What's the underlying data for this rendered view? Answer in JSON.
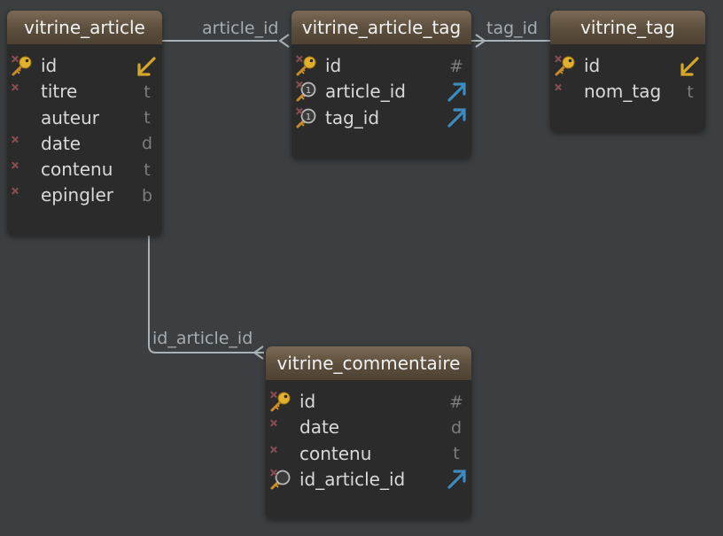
{
  "colors": {
    "background": "#3c3f41",
    "table_body": "#2b2b2b",
    "header_brown": "#6b5a47",
    "link_line": "#a9b2b8",
    "key_yellow": "#d4a62a",
    "fk_blue": "#3c8cc0"
  },
  "tables": [
    {
      "name": "vitrine_article",
      "columns": [
        {
          "name": "id",
          "icon": "primary-key-icon",
          "type": "pk-arrow-icon"
        },
        {
          "name": "titre",
          "icon": "not-null-mark-icon",
          "type": "t"
        },
        {
          "name": "auteur",
          "icon": "none",
          "type": "t"
        },
        {
          "name": "date",
          "icon": "not-null-mark-icon",
          "type": "d"
        },
        {
          "name": "contenu",
          "icon": "not-null-mark-icon",
          "type": "t"
        },
        {
          "name": "epingler",
          "icon": "not-null-mark-icon",
          "type": "b"
        }
      ]
    },
    {
      "name": "vitrine_article_tag",
      "columns": [
        {
          "name": "id",
          "icon": "primary-key-icon",
          "type": "#"
        },
        {
          "name": "article_id",
          "icon": "unique-index-key-icon",
          "type": "fk-arrow-icon"
        },
        {
          "name": "tag_id",
          "icon": "unique-index-key-icon",
          "type": "fk-arrow-icon"
        }
      ]
    },
    {
      "name": "vitrine_tag",
      "columns": [
        {
          "name": "id",
          "icon": "primary-key-icon",
          "type": "pk-arrow-icon"
        },
        {
          "name": "nom_tag",
          "icon": "not-null-mark-icon",
          "type": "t"
        }
      ]
    },
    {
      "name": "vitrine_commentaire",
      "columns": [
        {
          "name": "id",
          "icon": "primary-key-icon",
          "type": "#"
        },
        {
          "name": "date",
          "icon": "not-null-mark-icon",
          "type": "d"
        },
        {
          "name": "contenu",
          "icon": "not-null-mark-icon",
          "type": "t"
        },
        {
          "name": "id_article_id",
          "icon": "index-key-icon",
          "type": "fk-arrow-icon"
        }
      ]
    }
  ],
  "links": [
    {
      "label": "article_id",
      "from": "vitrine_article_tag",
      "to": "vitrine_article"
    },
    {
      "label": "tag_id",
      "from": "vitrine_article_tag",
      "to": "vitrine_tag"
    },
    {
      "label": "id_article_id",
      "from": "vitrine_commentaire",
      "to": "vitrine_article"
    }
  ]
}
